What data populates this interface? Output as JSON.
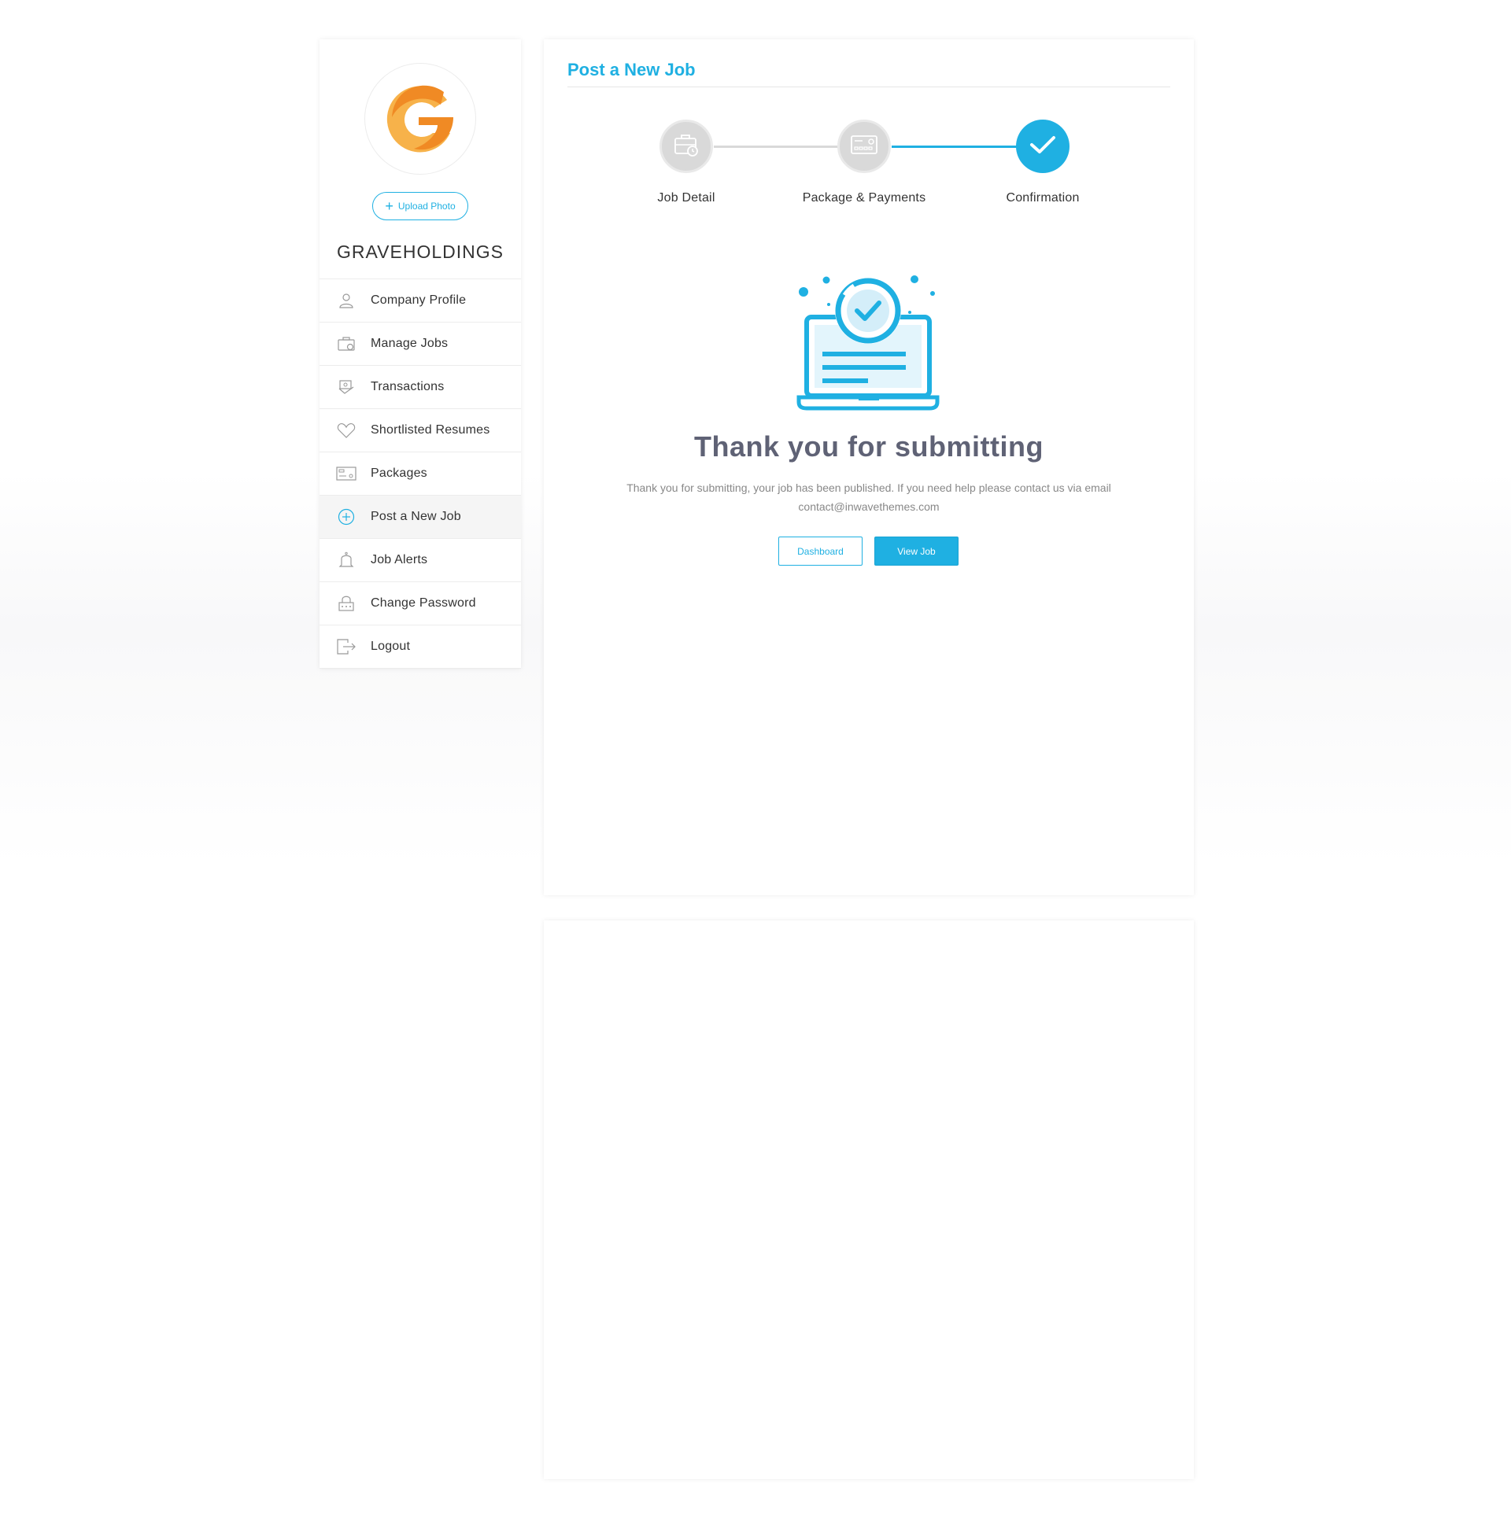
{
  "sidebar": {
    "upload_label": "Upload Photo",
    "company_name": "GRAVEHOLDINGS",
    "items": [
      {
        "label": "Company Profile",
        "icon": "user-icon"
      },
      {
        "label": "Manage Jobs",
        "icon": "briefcase-icon"
      },
      {
        "label": "Transactions",
        "icon": "transactions-icon"
      },
      {
        "label": "Shortlisted Resumes",
        "icon": "heart-icon"
      },
      {
        "label": "Packages",
        "icon": "card-icon"
      },
      {
        "label": "Post a New Job",
        "icon": "plus-circle-icon",
        "active": true
      },
      {
        "label": "Job Alerts",
        "icon": "bell-icon"
      },
      {
        "label": "Change Password",
        "icon": "lock-icon"
      },
      {
        "label": "Logout",
        "icon": "logout-icon"
      }
    ]
  },
  "main": {
    "title": "Post a New Job",
    "steps": [
      {
        "label": "Job Detail",
        "icon": "briefcase-clock-icon"
      },
      {
        "label": "Package & Payments",
        "icon": "credit-card-icon"
      },
      {
        "label": "Confirmation",
        "icon": "checkmark-icon"
      }
    ],
    "heading": "Thank you for submitting",
    "message": "Thank you for submitting, your job has been published. If you need help please contact us via email contact@inwavethemes.com",
    "buttons": {
      "dashboard": "Dashboard",
      "view_job": "View Job"
    }
  },
  "colors": {
    "accent": "#1fb0e2",
    "logo_orange": "#f08a24",
    "logo_light": "#f7b24a"
  }
}
